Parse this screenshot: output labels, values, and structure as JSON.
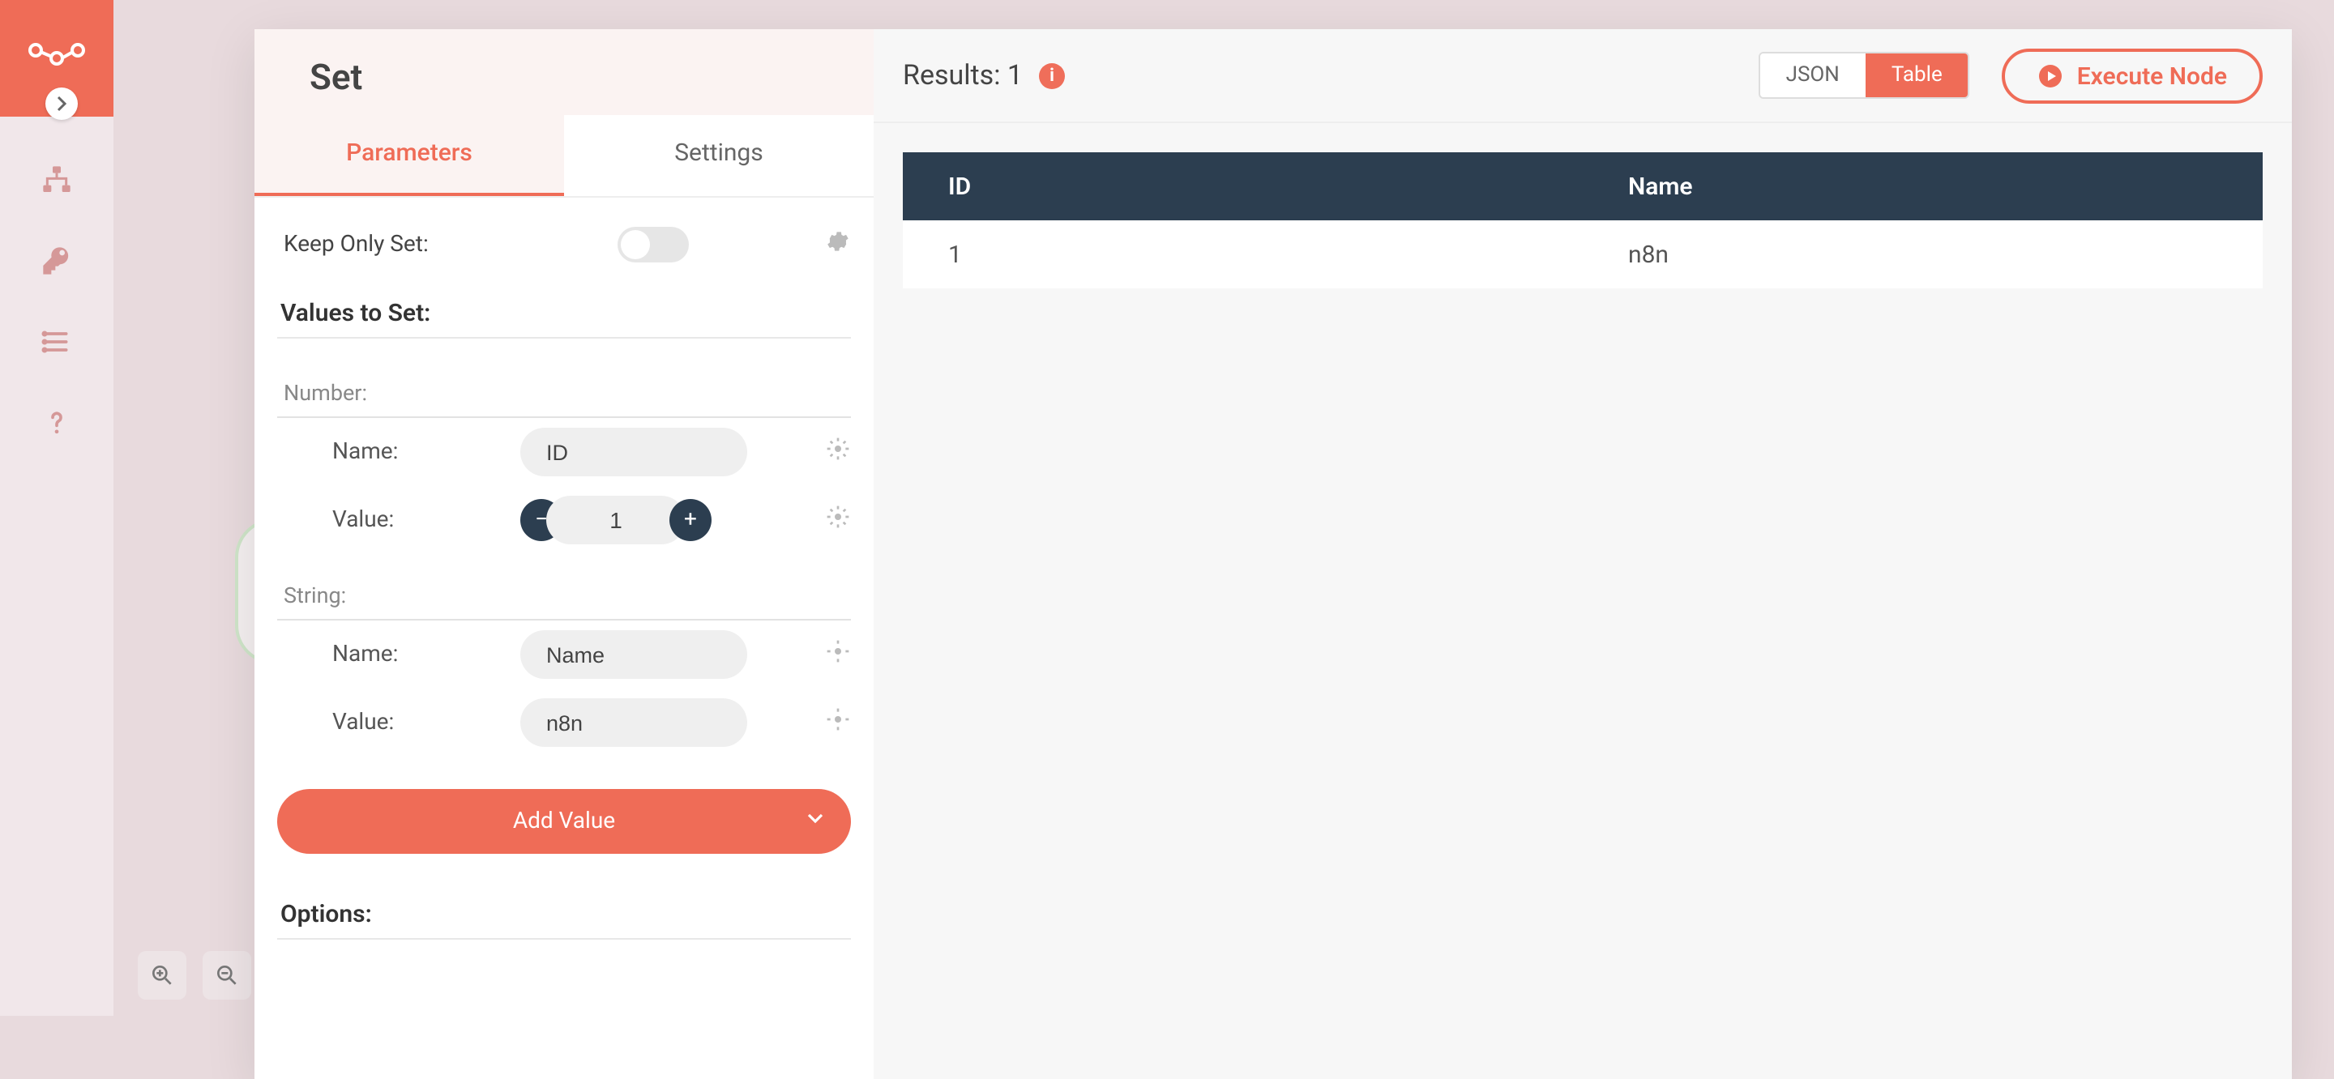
{
  "node": {
    "title": "Set",
    "tabs": {
      "parameters": "Parameters",
      "settings": "Settings"
    }
  },
  "params": {
    "keepOnlySet": {
      "label": "Keep Only Set:"
    },
    "valuesToSet": {
      "title": "Values to Set:"
    },
    "numberSection": {
      "title": "Number:",
      "nameLabel": "Name:",
      "nameValue": "ID",
      "valueLabel": "Value:",
      "valueValue": "1"
    },
    "stringSection": {
      "title": "String:",
      "nameLabel": "Name:",
      "nameValue": "Name",
      "valueLabel": "Value:",
      "valueValue": "n8n"
    },
    "addValue": "Add Value",
    "optionsTitle": "Options:"
  },
  "right": {
    "resultsLabel": "Results: 1",
    "views": {
      "json": "JSON",
      "table": "Table"
    },
    "execute": "Execute Node"
  },
  "table": {
    "headers": [
      "ID",
      "Name"
    ],
    "row": [
      "1",
      "n8n"
    ]
  }
}
